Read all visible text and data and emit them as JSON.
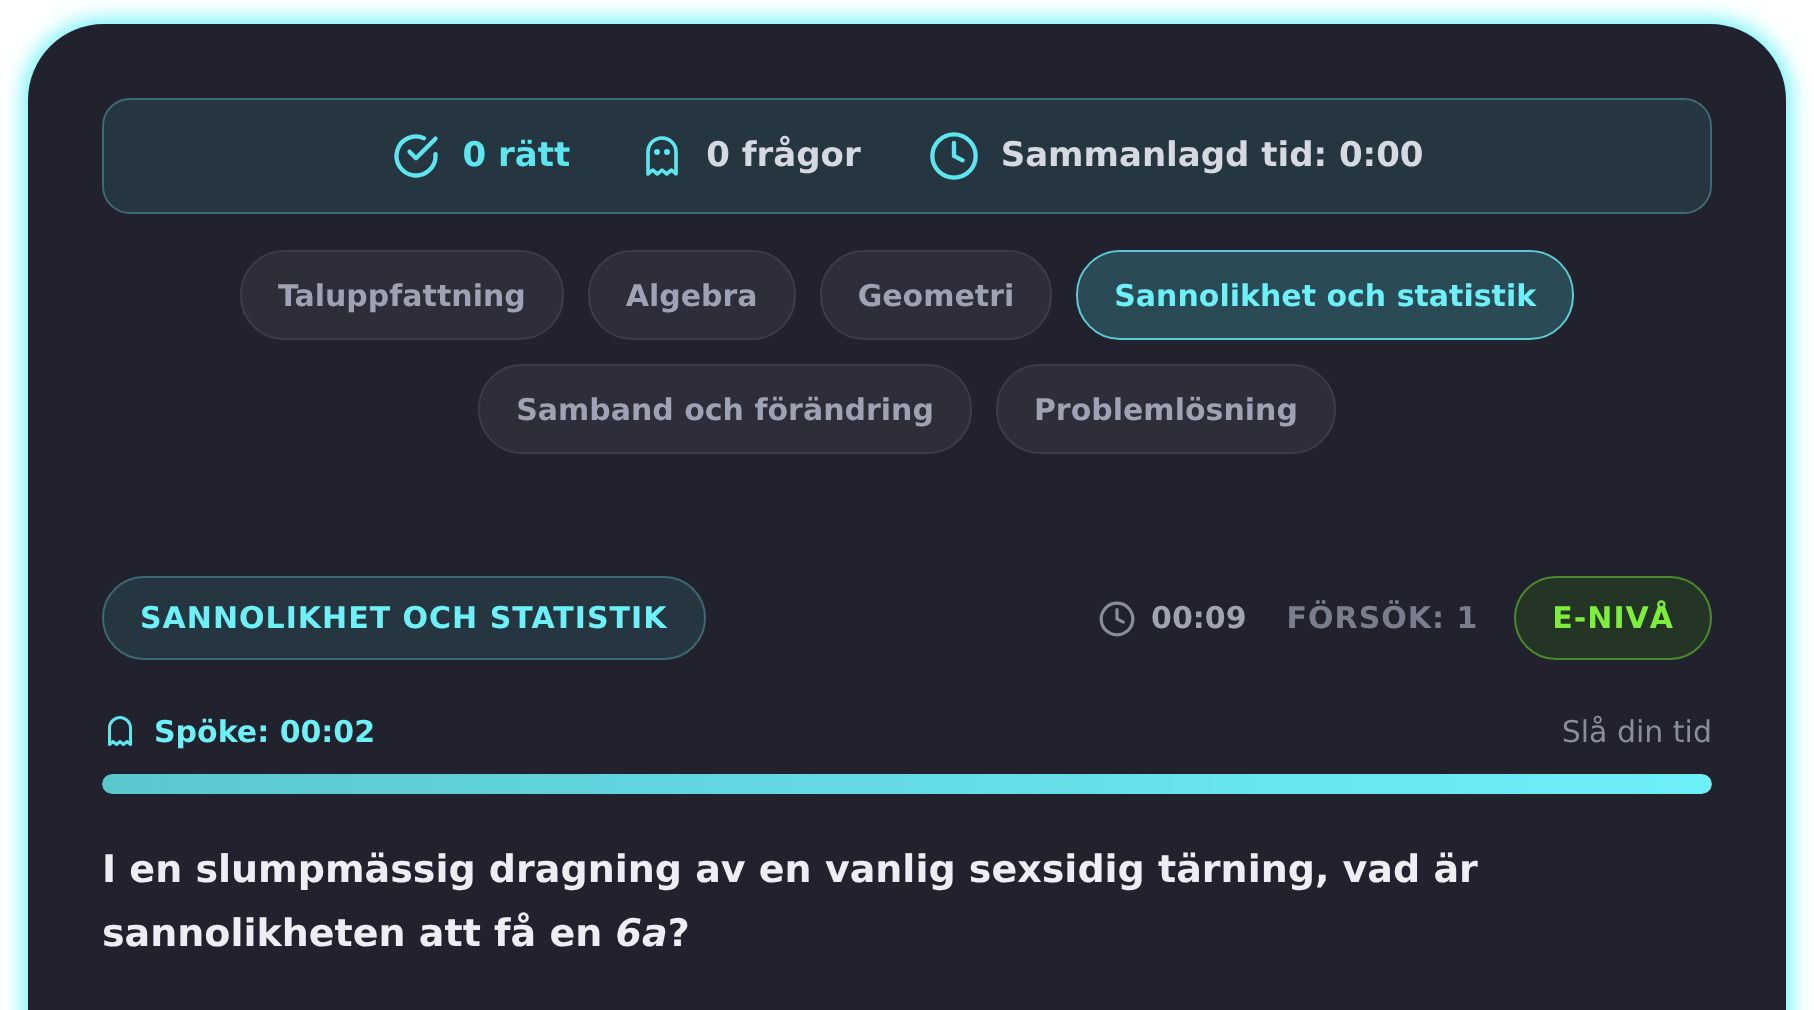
{
  "stats": [
    {
      "kind": "check",
      "text": "0 rätt"
    },
    {
      "kind": "ghost",
      "text": "0 frågor"
    },
    {
      "kind": "clock",
      "text": "Sammanlagd tid: 0:00"
    }
  ],
  "categories": [
    {
      "label": "Taluppfattning",
      "selected": false
    },
    {
      "label": "Algebra",
      "selected": false
    },
    {
      "label": "Geometri",
      "selected": false
    },
    {
      "label": "Sannolikhet och statistik",
      "selected": true
    },
    {
      "label": "Samband och förändring",
      "selected": false
    },
    {
      "label": "Problemlösning",
      "selected": false
    }
  ],
  "question_header": {
    "category": "SANNOLIKHET OCH STATISTIK",
    "timer": "00:09",
    "attempts": "FÖRSÖK: 1",
    "level_badge": "E-NIVÅ"
  },
  "ghost": {
    "label": "Spöke: 00:02",
    "hint": "Slå din tid",
    "level": 1
  },
  "question": "I en slumpmässig dragning av en vanlig sexsidig tärning, vad är sannolikheten att få en *6a*?"
}
